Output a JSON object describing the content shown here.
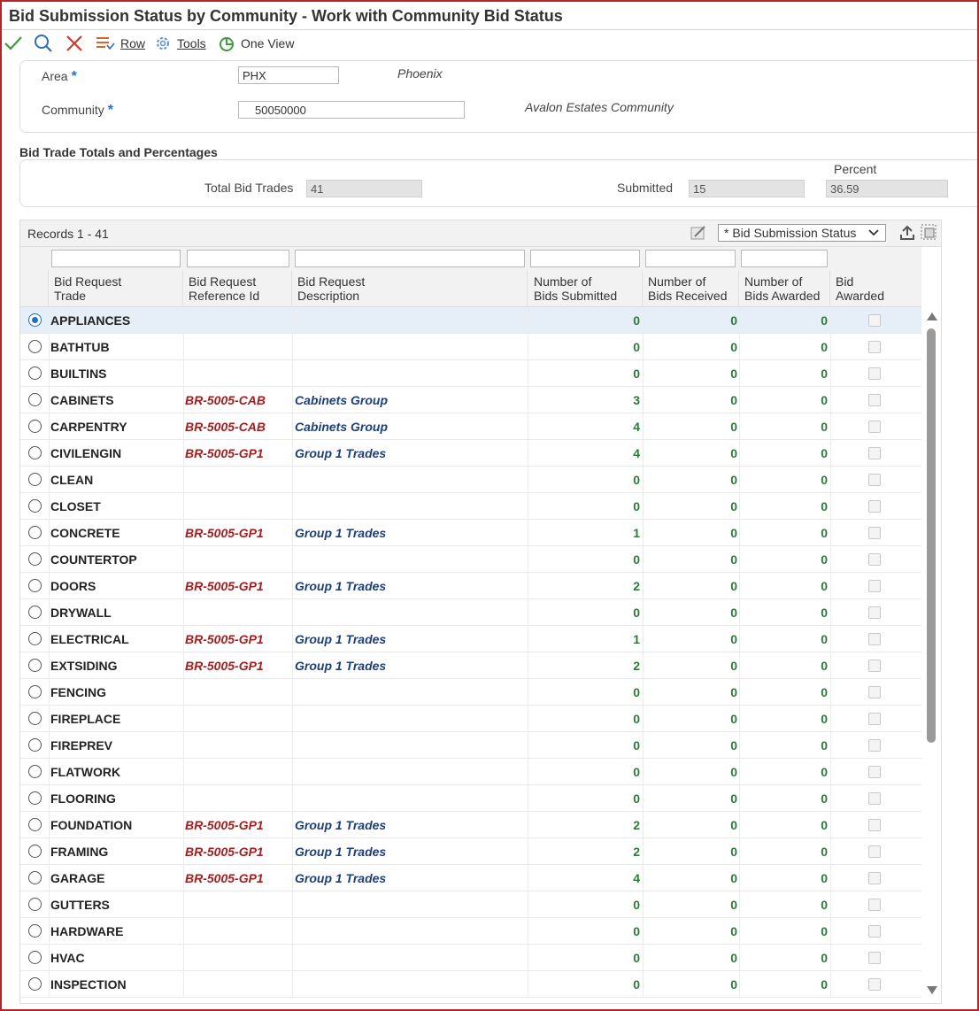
{
  "window": {
    "title": "Bid Submission Status by Community - Work with Community Bid Status"
  },
  "toolbar": {
    "ok_icon": "check-icon",
    "find_icon": "search-icon",
    "close_icon": "close-icon",
    "row_label": "Row",
    "tools_label": "Tools",
    "oneview_label": "One View"
  },
  "header": {
    "area_label": "Area",
    "area_required": "*",
    "area_value": "PHX",
    "area_desc": "Phoenix",
    "community_label": "Community",
    "community_required": "*",
    "community_value": "50050000",
    "community_desc": "Avalon Estates Community"
  },
  "totals": {
    "section_title": "Bid Trade Totals and Percentages",
    "total_label": "Total Bid Trades",
    "total_value": "41",
    "submitted_label": "Submitted",
    "submitted_value": "15",
    "percent_label": "Percent",
    "percent_value": "36.59"
  },
  "grid": {
    "records_label": "Records 1 - 41",
    "view_select": "* Bid Submission Status",
    "columns": [
      "Bid Request Trade",
      "Bid Request Reference Id",
      "Bid Request Description",
      "Number of Bids Submitted",
      "Number of Bids Received",
      "Number of Bids Awarded",
      "Bid Awarded"
    ],
    "column_lines": [
      [
        "Bid Request",
        "Trade"
      ],
      [
        "Bid Request",
        "Reference Id"
      ],
      [
        "Bid Request",
        "Description"
      ],
      [
        "Number of",
        "Bids Submitted"
      ],
      [
        "Number of",
        "Bids Received"
      ],
      [
        "Number of",
        "Bids Awarded"
      ],
      [
        "Bid",
        "Awarded"
      ]
    ],
    "rows": [
      {
        "trade": "APPLIANCES",
        "ref": "",
        "desc": "",
        "submitted": "0",
        "received": "0",
        "awarded": "0",
        "selected": true
      },
      {
        "trade": "BATHTUB",
        "ref": "",
        "desc": "",
        "submitted": "0",
        "received": "0",
        "awarded": "0"
      },
      {
        "trade": "BUILTINS",
        "ref": "",
        "desc": "",
        "submitted": "0",
        "received": "0",
        "awarded": "0"
      },
      {
        "trade": "CABINETS",
        "ref": "BR-5005-CAB",
        "desc": "Cabinets Group",
        "submitted": "3",
        "received": "0",
        "awarded": "0"
      },
      {
        "trade": "CARPENTRY",
        "ref": "BR-5005-CAB",
        "desc": "Cabinets Group",
        "submitted": "4",
        "received": "0",
        "awarded": "0"
      },
      {
        "trade": "CIVILENGIN",
        "ref": "BR-5005-GP1",
        "desc": "Group 1 Trades",
        "submitted": "4",
        "received": "0",
        "awarded": "0"
      },
      {
        "trade": "CLEAN",
        "ref": "",
        "desc": "",
        "submitted": "0",
        "received": "0",
        "awarded": "0"
      },
      {
        "trade": "CLOSET",
        "ref": "",
        "desc": "",
        "submitted": "0",
        "received": "0",
        "awarded": "0"
      },
      {
        "trade": "CONCRETE",
        "ref": "BR-5005-GP1",
        "desc": "Group 1 Trades",
        "submitted": "1",
        "received": "0",
        "awarded": "0"
      },
      {
        "trade": "COUNTERTOP",
        "ref": "",
        "desc": "",
        "submitted": "0",
        "received": "0",
        "awarded": "0"
      },
      {
        "trade": "DOORS",
        "ref": "BR-5005-GP1",
        "desc": "Group 1 Trades",
        "submitted": "2",
        "received": "0",
        "awarded": "0"
      },
      {
        "trade": "DRYWALL",
        "ref": "",
        "desc": "",
        "submitted": "0",
        "received": "0",
        "awarded": "0"
      },
      {
        "trade": "ELECTRICAL",
        "ref": "BR-5005-GP1",
        "desc": "Group 1 Trades",
        "submitted": "1",
        "received": "0",
        "awarded": "0"
      },
      {
        "trade": "EXTSIDING",
        "ref": "BR-5005-GP1",
        "desc": "Group 1 Trades",
        "submitted": "2",
        "received": "0",
        "awarded": "0"
      },
      {
        "trade": "FENCING",
        "ref": "",
        "desc": "",
        "submitted": "0",
        "received": "0",
        "awarded": "0"
      },
      {
        "trade": "FIREPLACE",
        "ref": "",
        "desc": "",
        "submitted": "0",
        "received": "0",
        "awarded": "0"
      },
      {
        "trade": "FIREPREV",
        "ref": "",
        "desc": "",
        "submitted": "0",
        "received": "0",
        "awarded": "0"
      },
      {
        "trade": "FLATWORK",
        "ref": "",
        "desc": "",
        "submitted": "0",
        "received": "0",
        "awarded": "0"
      },
      {
        "trade": "FLOORING",
        "ref": "",
        "desc": "",
        "submitted": "0",
        "received": "0",
        "awarded": "0"
      },
      {
        "trade": "FOUNDATION",
        "ref": "BR-5005-GP1",
        "desc": "Group 1 Trades",
        "submitted": "2",
        "received": "0",
        "awarded": "0"
      },
      {
        "trade": "FRAMING",
        "ref": "BR-5005-GP1",
        "desc": "Group 1 Trades",
        "submitted": "2",
        "received": "0",
        "awarded": "0"
      },
      {
        "trade": "GARAGE",
        "ref": "BR-5005-GP1",
        "desc": "Group 1 Trades",
        "submitted": "4",
        "received": "0",
        "awarded": "0"
      },
      {
        "trade": "GUTTERS",
        "ref": "",
        "desc": "",
        "submitted": "0",
        "received": "0",
        "awarded": "0"
      },
      {
        "trade": "HARDWARE",
        "ref": "",
        "desc": "",
        "submitted": "0",
        "received": "0",
        "awarded": "0"
      },
      {
        "trade": "HVAC",
        "ref": "",
        "desc": "",
        "submitted": "0",
        "received": "0",
        "awarded": "0"
      },
      {
        "trade": "INSPECTION",
        "ref": "",
        "desc": "",
        "submitted": "0",
        "received": "0",
        "awarded": "0"
      }
    ]
  },
  "colors": {
    "frame": "#b1262a",
    "ref_id": "#a31f1f",
    "description": "#1f3f7a",
    "count": "#2c7a3a",
    "selected_row": "#e6eef8"
  }
}
